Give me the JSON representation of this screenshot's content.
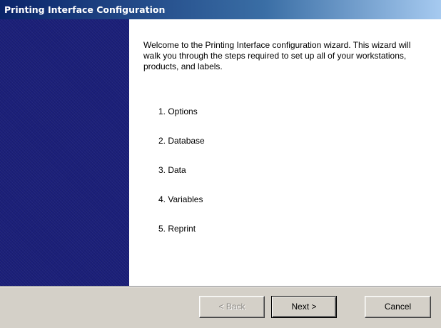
{
  "window": {
    "title": "Printing Interface Configuration"
  },
  "wizard": {
    "welcome_text": "Welcome to the Printing Interface configuration wizard. This wizard will walk you through the steps required to set up all of your workstations, products, and labels.",
    "steps": [
      "1. Options",
      "2. Database",
      "3. Data",
      "4. Variables",
      "5. Reprint"
    ]
  },
  "buttons": {
    "back_label": "< Back",
    "back_enabled": false,
    "next_label": "Next >",
    "cancel_label": "Cancel"
  },
  "colors": {
    "titlebar": "#0a246a",
    "side_panel": "#1b1f79",
    "dialog_face": "#d4d0c8"
  }
}
